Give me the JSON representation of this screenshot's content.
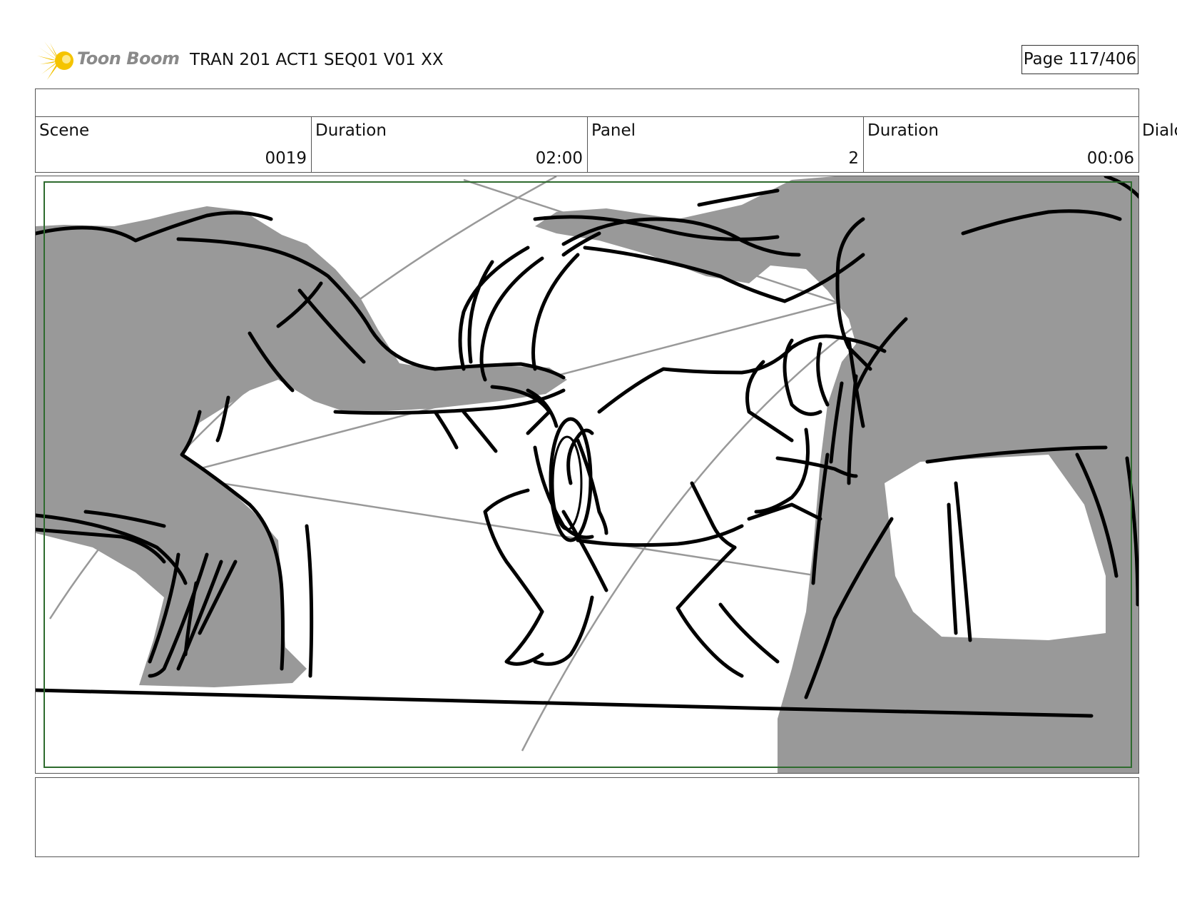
{
  "header": {
    "logo_text": "Toon Boom",
    "logo_icon": "starburst-logo-icon",
    "title": "TRAN 201 ACT1 SEQ01 V01 XX",
    "page": "Page 117/406"
  },
  "info": {
    "scene_label": "Scene",
    "scene_value": "0019",
    "scene_duration_label": "Duration",
    "scene_duration_value": "02:00",
    "panel_label": "Panel",
    "panel_value": "2",
    "panel_duration_label": "Duration",
    "panel_duration_value": "00:06",
    "dialog_label": "Dialog"
  },
  "colors": {
    "safe_frame": "#2e6b2e",
    "sketch_gray": "#999999",
    "logo_yellow": "#f2c200"
  }
}
